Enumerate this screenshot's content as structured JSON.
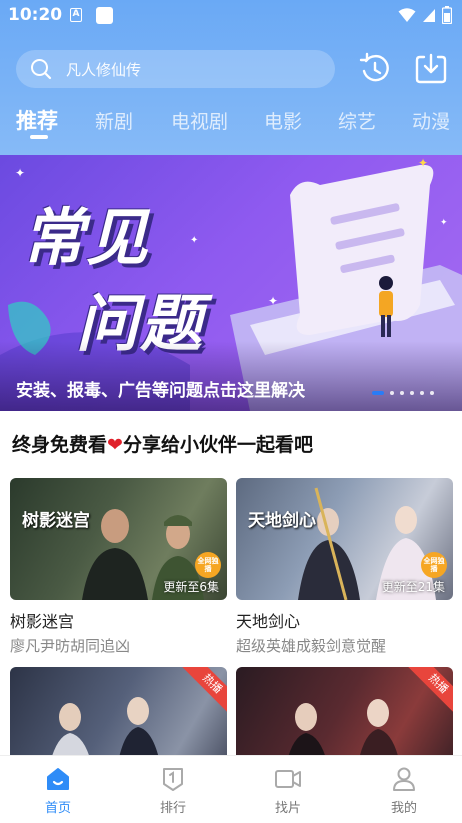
{
  "status_bar": {
    "time": "10:20",
    "a_icon_letter": "A"
  },
  "search": {
    "placeholder": "凡人修仙传"
  },
  "icons": {
    "history": "history-icon",
    "download": "download-icon",
    "search": "search-icon"
  },
  "tabs": [
    {
      "label": "推荐",
      "active": true
    },
    {
      "label": "新剧",
      "active": false
    },
    {
      "label": "电视剧",
      "active": false
    },
    {
      "label": "电影",
      "active": false
    },
    {
      "label": "综艺",
      "active": false
    },
    {
      "label": "动漫",
      "active": false
    }
  ],
  "banner": {
    "title_line1": "常见",
    "title_line2": "问题",
    "caption": "安装、报毒、广告等问题点击这里解决",
    "dots_count": 6,
    "active_dot": 0
  },
  "section": {
    "title_before": "终身免费看",
    "title_after": "分享给小伙伴一起看吧"
  },
  "cards": [
    {
      "title": "树影迷宫",
      "subtitle": "廖凡尹昉胡同追凶",
      "update": "更新至6集",
      "badge": "全网独播",
      "logo": "树影迷宫"
    },
    {
      "title": "天地剑心",
      "subtitle": "超级英雄成毅剑意觉醒",
      "update": "更新至21集",
      "badge": "全网独播",
      "logo": "天地剑心"
    },
    {
      "ribbon": "热播"
    },
    {
      "ribbon": "热播"
    }
  ],
  "bottom_nav": [
    {
      "label": "首页",
      "icon": "home-icon",
      "active": true
    },
    {
      "label": "排行",
      "icon": "ranking-icon",
      "active": false
    },
    {
      "label": "找片",
      "icon": "video-icon",
      "active": false
    },
    {
      "label": "我的",
      "icon": "profile-icon",
      "active": false
    }
  ],
  "colors": {
    "accent": "#2f8cf7",
    "header": "#6aa9f5",
    "banner": "#7b52e8",
    "heart": "#e0202a"
  }
}
